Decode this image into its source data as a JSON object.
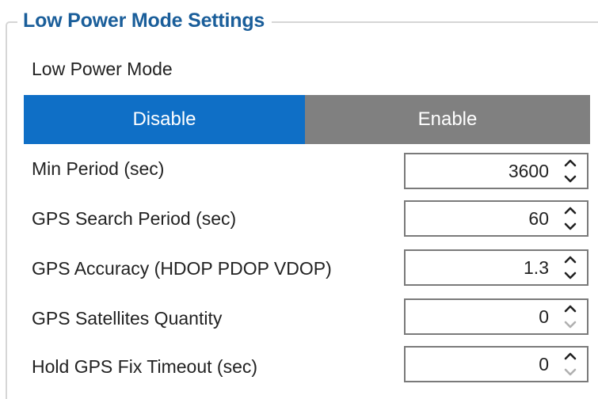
{
  "group": {
    "title": "Low Power Mode Settings"
  },
  "low_power_mode": {
    "label": "Low Power Mode",
    "options": [
      "Disable",
      "Enable"
    ],
    "selected": "Disable"
  },
  "fields": [
    {
      "label": "Min Period   (sec)",
      "value": "3600",
      "down_enabled": true
    },
    {
      "label": "GPS Search Period   (sec)",
      "value": "60",
      "down_enabled": true
    },
    {
      "label": "GPS Accuracy (HDOP PDOP VDOP)",
      "value": "1.3",
      "down_enabled": true
    },
    {
      "label": "GPS Satellites Quantity",
      "value": "0",
      "down_enabled": false
    },
    {
      "label": "Hold GPS Fix Timeout   (sec)",
      "value": "0",
      "down_enabled": false
    }
  ],
  "colors": {
    "title": "#1a5e9a",
    "active_button": "#0f6fc6",
    "inactive_button": "#808080",
    "arrow_enabled": "#222222",
    "arrow_disabled": "#b0b0b0"
  },
  "icons": {
    "up": "chevron-up-icon",
    "down": "chevron-down-icon"
  }
}
